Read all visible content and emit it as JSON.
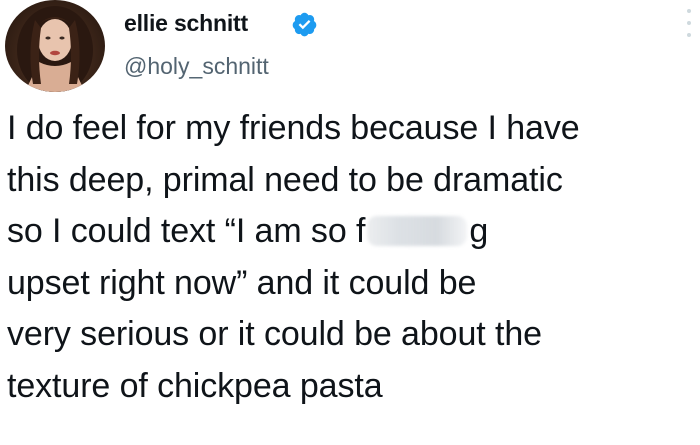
{
  "user": {
    "display_name": "ellie schnitt",
    "handle": "@holy_schnitt",
    "verified": true,
    "verified_color": "#1d9bf0"
  },
  "tweet": {
    "lines": [
      "I do feel for my friends because I have",
      "this deep, primal need to be dramatic",
      "so I could text “I am so f",
      "g",
      "upset right now” and it could be",
      "very serious or it could be about the",
      "texture of chickpea pasta"
    ]
  },
  "icons": {
    "avatar": "profile-photo",
    "verified": "verified-badge-icon",
    "more": "more-options-icon"
  },
  "colors": {
    "text": "#0f1419",
    "secondary": "#536471",
    "background": "#ffffff"
  }
}
